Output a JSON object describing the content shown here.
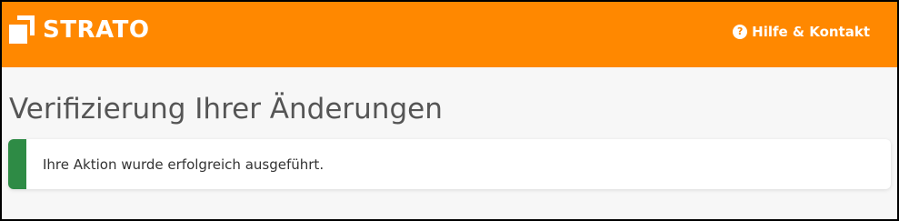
{
  "header": {
    "logo_text": "STRATO",
    "help_label": "Hilfe & Kontakt",
    "help_icon": "question-circle-icon",
    "background_color": "#ff8800"
  },
  "main": {
    "title": "Verifizierung Ihrer Änderungen",
    "alert": {
      "message": "Ihre Aktion wurde erfolgreich ausgeführt.",
      "status": "success",
      "accent_color": "#2e8b45"
    }
  }
}
